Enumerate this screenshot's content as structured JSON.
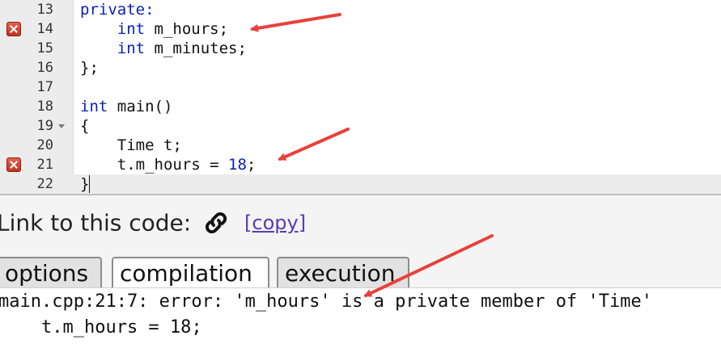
{
  "editor": {
    "lines": [
      {
        "num": "13",
        "code": "private:"
      },
      {
        "num": "14",
        "code": "    int m_hours;",
        "error": true
      },
      {
        "num": "15",
        "code": "    int m_minutes;"
      },
      {
        "num": "16",
        "code": "};"
      },
      {
        "num": "17",
        "code": ""
      },
      {
        "num": "18",
        "code": "int main()"
      },
      {
        "num": "19",
        "code": "{",
        "fold": true
      },
      {
        "num": "20",
        "code": "    Time t;"
      },
      {
        "num": "21",
        "code": "    t.m_hours = 18;",
        "error": true
      },
      {
        "num": "22",
        "code": "}",
        "active": true
      }
    ]
  },
  "link_section": {
    "label": "Link to this code:",
    "icon": "link-icon",
    "copy_label": "[copy]"
  },
  "tabs": [
    {
      "label": "options"
    },
    {
      "label": "compilation",
      "active": true
    },
    {
      "label": "execution"
    }
  ],
  "output": {
    "lines": [
      "main.cpp:21:7: error: 'm_hours' is a private member of 'Time'",
      "    t.m_hours = 18;"
    ]
  },
  "colors": {
    "keyword": "#0a22b6",
    "annotation_arrow": "#e8413c",
    "error_marker": "#d04631",
    "copy_link": "#5a3cb0"
  }
}
